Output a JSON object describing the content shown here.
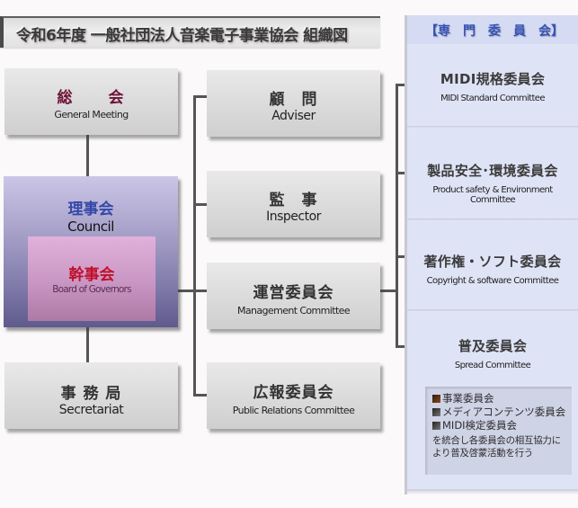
{
  "title": "令和6年度  一般社団法人音楽電子事業協会   組織図",
  "left_column": {
    "general_meeting": {
      "jp": "総　　会",
      "en": "General Meeting"
    },
    "council": {
      "jp": "理事会",
      "en": "Council"
    },
    "board_of_governors": {
      "jp": "幹事会",
      "en": "Board of Governors"
    },
    "secretariat": {
      "jp": "事 務 局",
      "en": "Secretariat"
    }
  },
  "middle_column": {
    "adviser": {
      "jp": "顧　問",
      "en": "Adviser"
    },
    "inspector": {
      "jp": "監　事",
      "en": "Inspector"
    },
    "management": {
      "jp": "運営委員会",
      "en": "Management Committee"
    },
    "public_relations": {
      "jp": "広報委員会",
      "en": "Public Relations Committee"
    }
  },
  "committee_panel": {
    "header": "【専　門　委　員　会】",
    "items": [
      {
        "jp": "MIDI規格委員会",
        "en": "MIDI Standard Committee"
      },
      {
        "jp": "製品安全･環境委員会",
        "en": "Product safety & Environment Committee"
      },
      {
        "jp": "著作権・ソフト委員会",
        "en": "Copyright & software Committee"
      },
      {
        "jp": "普及委員会",
        "en": "Spread Committee"
      }
    ],
    "sub_committees": [
      {
        "label": "事業委員会",
        "color": "#6b3a1a"
      },
      {
        "label": "メディアコンテンツ委員会",
        "color": "#4a4a4a"
      },
      {
        "label": "MIDI検定委員会",
        "color": "#4a4a4a"
      }
    ],
    "sub_note": "を統合し各委員会の相互協力により普及啓蒙活動を行う"
  },
  "colors": {
    "general_meeting_jp": "#6e1238",
    "council_jp": "#3348a8",
    "governors_jp": "#c0102a",
    "panel_header": "#3553b8"
  }
}
